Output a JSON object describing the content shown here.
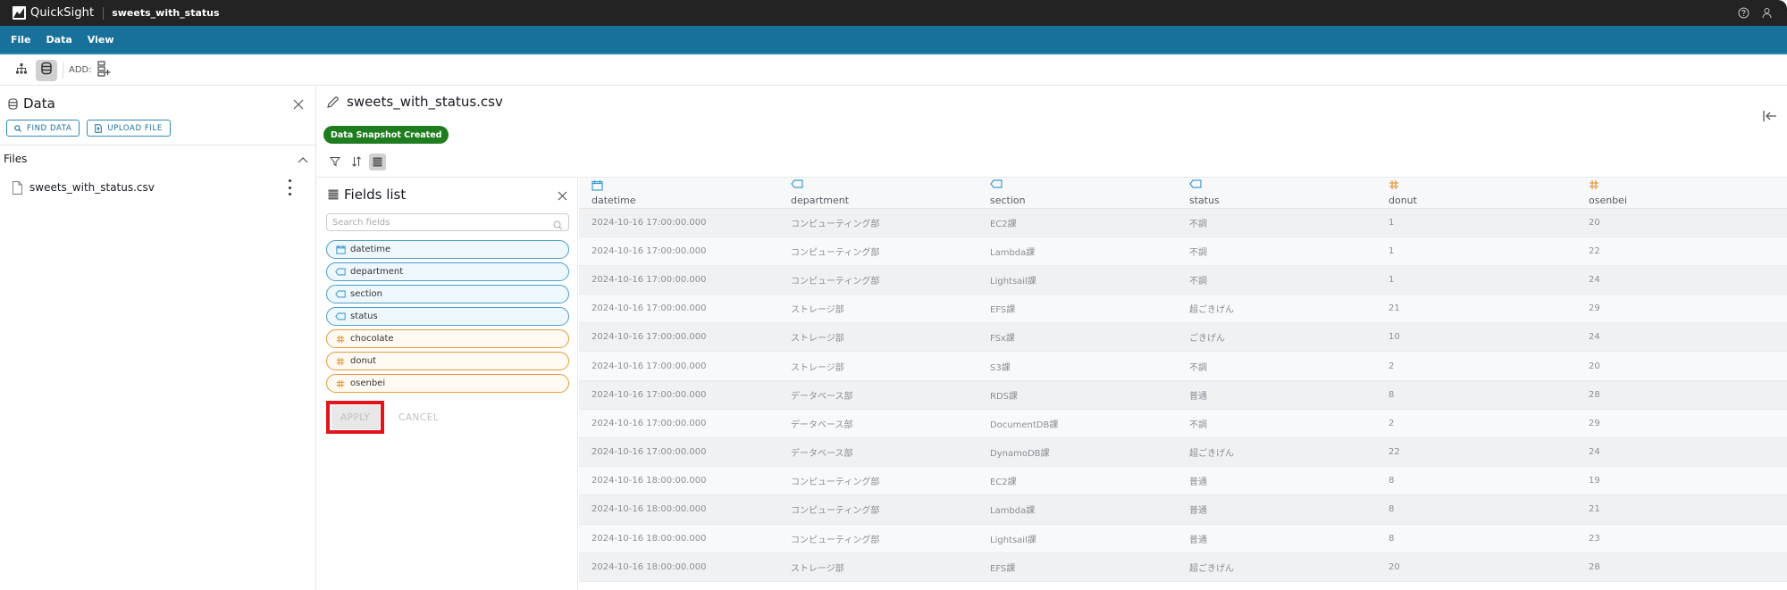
{
  "app": {
    "name": "QuickSight",
    "document_title": "sweets_with_status"
  },
  "titlebar": {
    "icons": [
      "help-icon",
      "user-icon"
    ]
  },
  "menubar": {
    "items": [
      {
        "label": "File"
      },
      {
        "label": "Data"
      },
      {
        "label": "View"
      }
    ]
  },
  "toolbar": {
    "add_label": "ADD:",
    "icons": [
      "hierarchy-icon",
      "database-icon",
      "add-dataset-icon"
    ]
  },
  "data_panel": {
    "title": "Data",
    "find_data_label": "FIND DATA",
    "upload_file_label": "UPLOAD FILE",
    "files_section_label": "Files",
    "files": [
      {
        "name": "sweets_with_status.csv"
      }
    ]
  },
  "main": {
    "title": "sweets_with_status.csv",
    "badge": "Data Snapshot Created",
    "colors": {
      "badge_bg": "#1e7d1e",
      "menubar_bg": "#17719a",
      "dimension_color": "#4a9ec9",
      "measure_color": "#e39a3b",
      "highlight_border": "#e4131b"
    }
  },
  "fields_list": {
    "title": "Fields list",
    "search_placeholder": "Search fields",
    "fields": [
      {
        "name": "datetime",
        "type": "date"
      },
      {
        "name": "department",
        "type": "dimension"
      },
      {
        "name": "section",
        "type": "dimension"
      },
      {
        "name": "status",
        "type": "dimension"
      },
      {
        "name": "chocolate",
        "type": "measure"
      },
      {
        "name": "donut",
        "type": "measure"
      },
      {
        "name": "osenbei",
        "type": "measure"
      }
    ],
    "apply_label": "APPLY",
    "cancel_label": "CANCEL"
  },
  "table": {
    "columns": [
      {
        "name": "datetime",
        "type": "date"
      },
      {
        "name": "department",
        "type": "dimension"
      },
      {
        "name": "section",
        "type": "dimension"
      },
      {
        "name": "status",
        "type": "dimension"
      },
      {
        "name": "donut",
        "type": "measure"
      },
      {
        "name": "osenbei",
        "type": "measure"
      }
    ],
    "rows": [
      [
        "2024-10-16 17:00:00.000",
        "コンピューティング部",
        "EC2課",
        "不調",
        "1",
        "20"
      ],
      [
        "2024-10-16 17:00:00.000",
        "コンピューティング部",
        "Lambda課",
        "不調",
        "1",
        "22"
      ],
      [
        "2024-10-16 17:00:00.000",
        "コンピューティング部",
        "Lightsail課",
        "不調",
        "1",
        "24"
      ],
      [
        "2024-10-16 17:00:00.000",
        "ストレージ部",
        "EFS課",
        "超ごきげん",
        "21",
        "29"
      ],
      [
        "2024-10-16 17:00:00.000",
        "ストレージ部",
        "FSx課",
        "ごきげん",
        "10",
        "24"
      ],
      [
        "2024-10-16 17:00:00.000",
        "ストレージ部",
        "S3課",
        "不調",
        "2",
        "20"
      ],
      [
        "2024-10-16 17:00:00.000",
        "データベース部",
        "RDS課",
        "普通",
        "8",
        "28"
      ],
      [
        "2024-10-16 17:00:00.000",
        "データベース部",
        "DocumentDB課",
        "不調",
        "2",
        "29"
      ],
      [
        "2024-10-16 17:00:00.000",
        "データベース部",
        "DynamoDB課",
        "超ごきげん",
        "22",
        "24"
      ],
      [
        "2024-10-16 18:00:00.000",
        "コンピューティング部",
        "EC2課",
        "普通",
        "8",
        "19"
      ],
      [
        "2024-10-16 18:00:00.000",
        "コンピューティング部",
        "Lambda課",
        "普通",
        "8",
        "21"
      ],
      [
        "2024-10-16 18:00:00.000",
        "コンピューティング部",
        "Lightsail課",
        "普通",
        "8",
        "23"
      ],
      [
        "2024-10-16 18:00:00.000",
        "ストレージ部",
        "EFS課",
        "超ごきげん",
        "20",
        "28"
      ]
    ]
  }
}
